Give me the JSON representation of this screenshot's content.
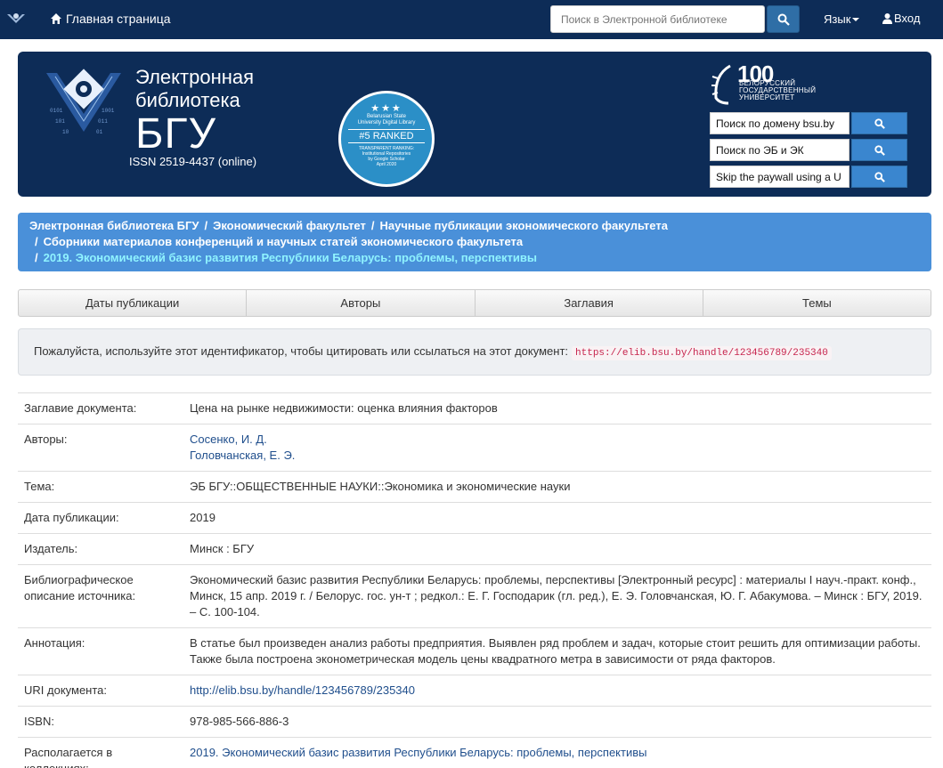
{
  "topnav": {
    "home_label": "Главная страница",
    "search_placeholder": "Поиск в Электронной библиотеке",
    "language_label": "Язык",
    "login_label": "Вход"
  },
  "banner": {
    "title_line1": "Электронная",
    "title_line2": "библиотека",
    "title_line3": "БГУ",
    "issn": "ISSN 2519-4437 (online)",
    "badge": {
      "stars": "★★★",
      "line1": "Belarusian State",
      "line2": "University Digital Library",
      "rank": "#5 RANKED",
      "line3": "TRANSPARENT RANKING:",
      "line4": "Institutional Repositories",
      "line5": "by Google Scholar",
      "line6": "April 2020"
    },
    "bsu_logo": {
      "number": "100",
      "line1": "БЕЛОРУССКИЙ",
      "line2": "ГОСУДАРСТВЕННЫЙ",
      "line3": "УНИВЕРСИТЕТ"
    },
    "search_boxes": [
      {
        "value": "Поиск по домену bsu.by"
      },
      {
        "value": "Поиск по ЭБ и ЭК"
      },
      {
        "value": "Skip the paywall using a U"
      }
    ]
  },
  "breadcrumb": {
    "items": [
      "Электронная библиотека БГУ",
      "Экономический факультет",
      "Научные публикации экономического факультета",
      "Сборники материалов конференций и научных статей экономического факультета"
    ],
    "active": "2019. Экономический базис развития Республики Беларусь: проблемы, перспективы"
  },
  "tabs": [
    "Даты публикации",
    "Авторы",
    "Заглавия",
    "Темы"
  ],
  "cite": {
    "text": "Пожалуйста, используйте этот идентификатор, чтобы цитировать или ссылаться на этот документ:",
    "url": "https://elib.bsu.by/handle/123456789/235340"
  },
  "metadata": {
    "title_label": "Заглавие документа:",
    "title_value": "Цена на рынке недвижимости: оценка влияния факторов",
    "authors_label": "Авторы:",
    "authors": [
      "Сосенко, И. Д.",
      "Головчанская, Е. Э."
    ],
    "subject_label": "Тема:",
    "subject_value": "ЭБ БГУ::ОБЩЕСТВЕННЫЕ НАУКИ::Экономика и экономические науки",
    "date_label": "Дата публикации:",
    "date_value": "2019",
    "publisher_label": "Издатель:",
    "publisher_value": "Минск : БГУ",
    "citation_label_1": "Библиографическое",
    "citation_label_2": "описание источника:",
    "citation_value": "Экономический базис развития Республики Беларусь: проблемы, перспективы [Электронный ресурс] : материалы I науч.-практ. конф., Минск, 15 апр. 2019 г. / Белорус. гос. ун-т ; редкол.: Е. Г. Господарик (гл. ред.), Е. Э. Головчанская, Ю. Г. Абакумова. – Минск : БГУ, 2019. – С. 100-104.",
    "abstract_label": "Аннотация:",
    "abstract_value": "В статье был произведен анализ работы предприятия. Выявлен ряд проблем и задач, которые стоит решить для оптимизации работы. Также была построена эконометрическая модель цены квадратного метра в зависимости от ряда факторов.",
    "uri_label": "URI документа:",
    "uri_value": "http://elib.bsu.by/handle/123456789/235340",
    "isbn_label": "ISBN:",
    "isbn_value": "978-985-566-886-3",
    "collections_label": "Располагается в коллекциях:",
    "collections_value": "2019. Экономический базис развития Республики Беларусь: проблемы, перспективы"
  },
  "colors": {
    "navbar": "#0d2c57",
    "breadcrumb_bg": "#4a90d9",
    "breadcrumb_active": "#8ff3ff",
    "link": "#1f4e8c",
    "button": "#3a86cf"
  }
}
